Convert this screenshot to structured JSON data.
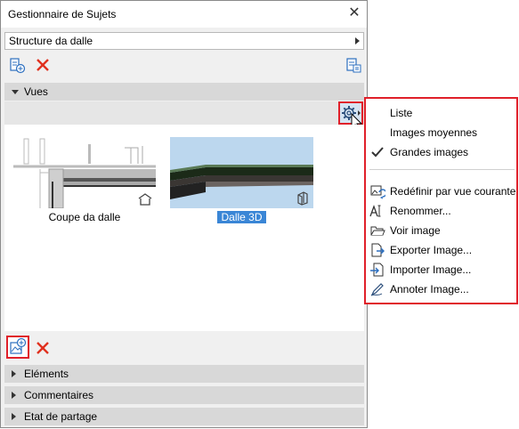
{
  "window": {
    "title": "Gestionnaire de Sujets",
    "close_symbol": "✕"
  },
  "structure": {
    "label": "Structure da dalle"
  },
  "sections": {
    "vues": "Vues",
    "elements": "Eléments",
    "commentaires": "Commentaires",
    "etat": "Etat de partage"
  },
  "thumbnails": [
    {
      "label": "Coupe da dalle",
      "icon": "section-icon",
      "selected": false
    },
    {
      "label": "Dalle 3D",
      "icon": "3d-view-icon",
      "selected": true
    }
  ],
  "menu": {
    "items": [
      {
        "label": "Liste",
        "icon": "",
        "checked": false
      },
      {
        "label": "Images moyennes",
        "icon": "",
        "checked": false
      },
      {
        "label": "Grandes images",
        "icon": "checkmark-icon",
        "checked": true
      },
      {
        "label": "Redéfinir par vue courante",
        "icon": "redefine-icon"
      },
      {
        "label": "Renommer...",
        "icon": "rename-icon"
      },
      {
        "label": "Voir image",
        "icon": "folder-open-icon"
      },
      {
        "label": "Exporter Image...",
        "icon": "export-icon"
      },
      {
        "label": "Importer Image...",
        "icon": "import-icon"
      },
      {
        "label": "Annoter Image...",
        "icon": "annotate-icon"
      }
    ]
  },
  "colors": {
    "highlight_red": "#e0202a",
    "delete_red": "#e0301e",
    "selection_blue": "#3a86d6"
  }
}
